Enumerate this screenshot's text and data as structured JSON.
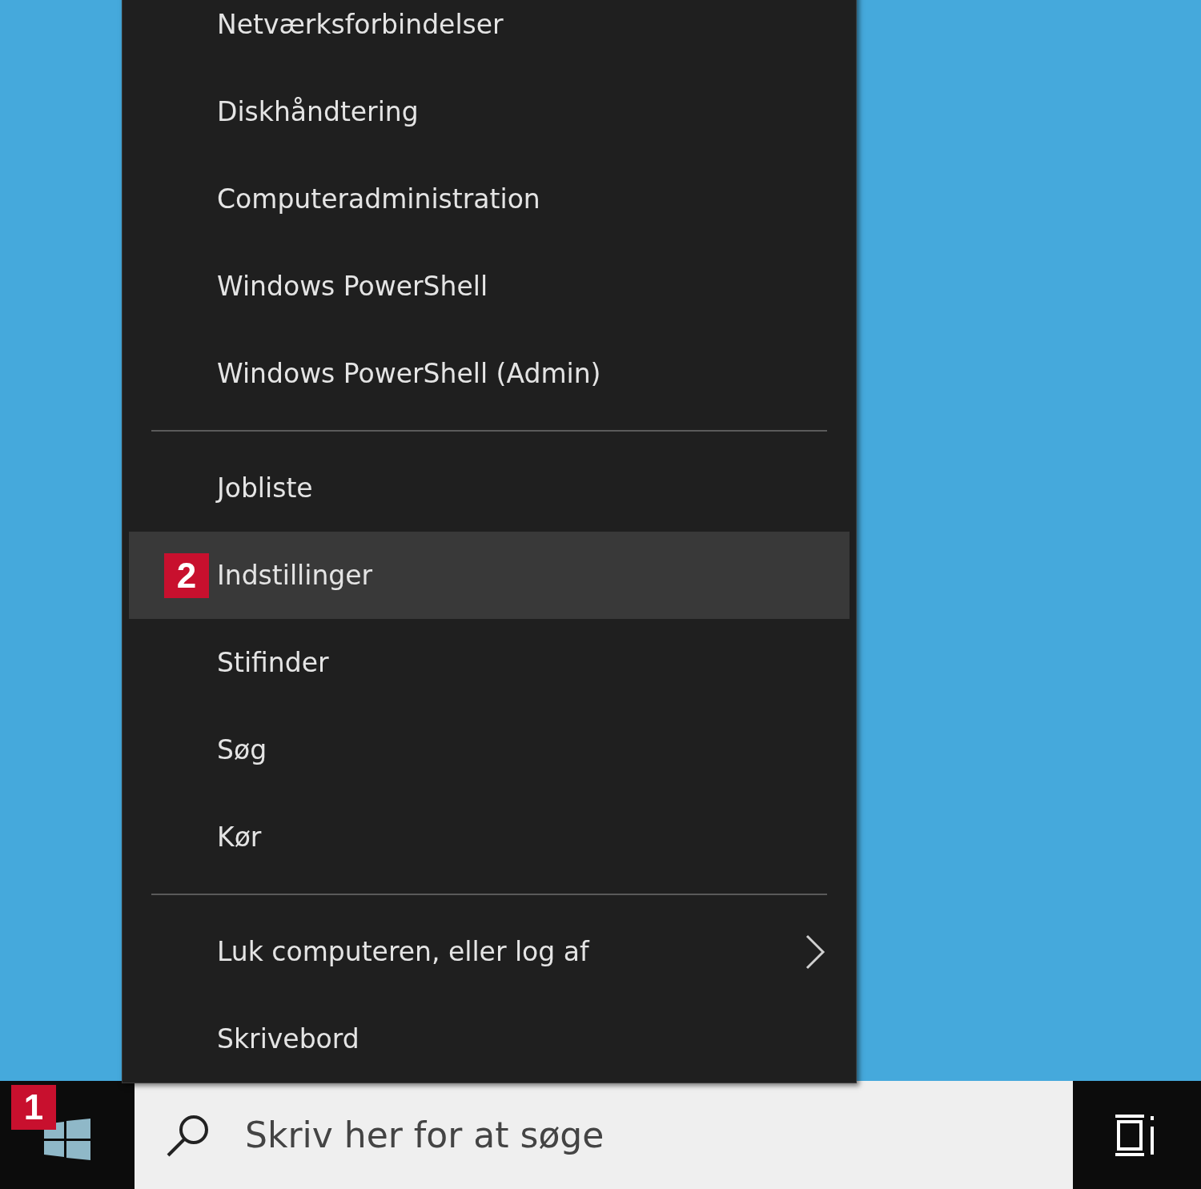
{
  "menu": {
    "items": [
      {
        "kind": "item",
        "label": "Netværksforbindelser",
        "highlighted": false
      },
      {
        "kind": "item",
        "label": "Diskhåndtering",
        "highlighted": false
      },
      {
        "kind": "item",
        "label": "Computeradministration",
        "highlighted": false
      },
      {
        "kind": "item",
        "label": "Windows PowerShell",
        "highlighted": false
      },
      {
        "kind": "item",
        "label": "Windows PowerShell (Admin)",
        "highlighted": false
      },
      {
        "kind": "separator"
      },
      {
        "kind": "item",
        "label": "Jobliste",
        "highlighted": false
      },
      {
        "kind": "item",
        "label": "Indstillinger",
        "highlighted": true,
        "badge": "2"
      },
      {
        "kind": "item",
        "label": "Stifinder",
        "highlighted": false
      },
      {
        "kind": "item",
        "label": "Søg",
        "highlighted": false
      },
      {
        "kind": "item",
        "label": "Kør",
        "highlighted": false
      },
      {
        "kind": "separator"
      },
      {
        "kind": "submenu",
        "label": "Luk computeren, eller log af",
        "highlighted": false
      },
      {
        "kind": "item",
        "label": "Skrivebord",
        "highlighted": false
      }
    ]
  },
  "taskbar": {
    "start_badge": "1",
    "search": {
      "placeholder": "Skriv her for at søge"
    }
  }
}
